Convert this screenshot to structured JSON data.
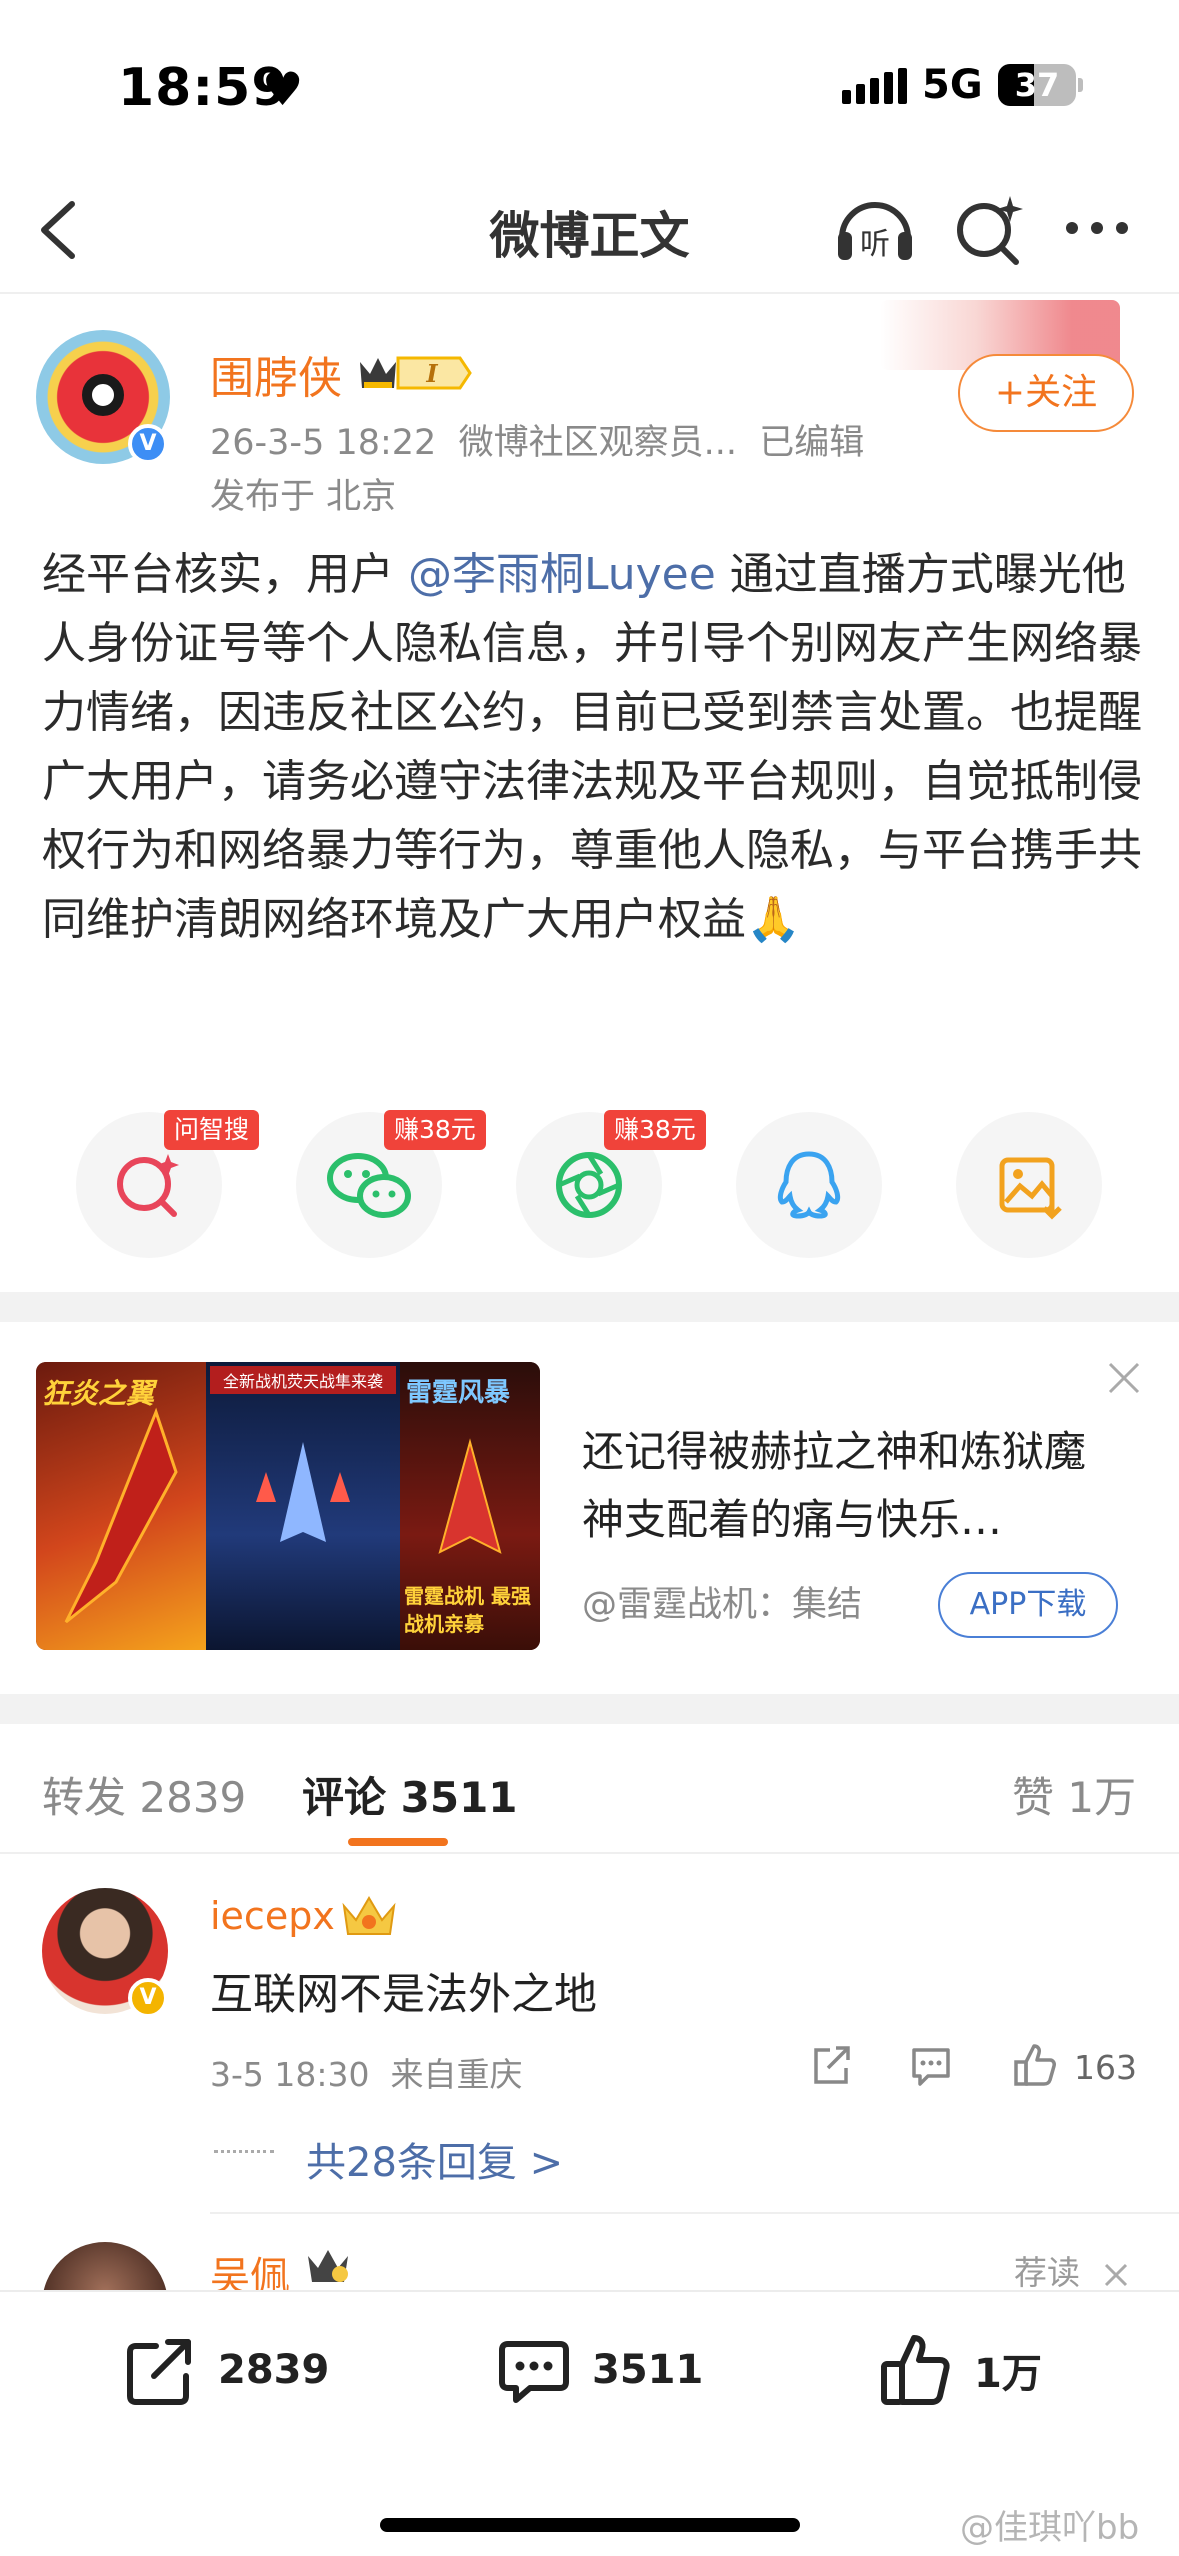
{
  "status_bar": {
    "time": "18:59",
    "network": "5G",
    "battery": "37"
  },
  "nav": {
    "title": "微博正文"
  },
  "post": {
    "username": "围脖侠",
    "badge_level": "I",
    "meta": "26-3-5 18:22  微博社区观察员...  已编辑",
    "location": "发布于 北京",
    "follow_label": "+关注",
    "text_before": "经平台核实，用户 ",
    "mention": "@李雨桐Luyee",
    "text_after": " 通过直播方式曝光他人身份证号等个人隐私信息，并引导个别网友产生网络暴力情绪，因违反社区公约，目前已受到禁言处置。也提醒广大用户，请务必遵守法律法规及平台规则，自觉抵制侵权行为和网络暴力等行为，尊重他人隐私，与平台携手共同维护清朗网络环境及广大用户权益🙏"
  },
  "share": {
    "items": [
      {
        "icon": "ai-search-icon",
        "tag": "问智搜"
      },
      {
        "icon": "wechat-icon",
        "tag": "赚38元"
      },
      {
        "icon": "moments-icon",
        "tag": "赚38元"
      },
      {
        "icon": "qq-icon",
        "tag": ""
      },
      {
        "icon": "save-image-icon",
        "tag": ""
      }
    ]
  },
  "ad": {
    "title": "还记得被赫拉之神和炼狱魔神支配着的痛与快乐…",
    "source": "@雷霆战机：集结",
    "button": "APP下载",
    "image_text_left": "狂炎之翼",
    "image_text_mid": "全新战机荧天战隼来袭",
    "image_text_right_top": "雷霆风暴",
    "image_text_right_bottom": "雷霆战机 最强战机亲募"
  },
  "tabs": {
    "repost_label": "转发",
    "repost_count": "2839",
    "comment_label": "评论",
    "comment_count": "3511",
    "like_label": "赞",
    "like_count": "1万"
  },
  "comments": [
    {
      "name": "iecepx",
      "text": "互联网不是法外之地",
      "meta": "3-5 18:30  来自重庆",
      "likes": "163",
      "replies": "共28条回复 >"
    },
    {
      "name": "吴佩",
      "recommend": "荐读"
    }
  ],
  "bottom": {
    "repost": "2839",
    "comment": "3511",
    "like": "1万"
  },
  "watermark": "@佳琪吖bb",
  "colors": {
    "accent": "#f2741e",
    "link": "#4d6ea8",
    "tag_red": "#f0433a"
  }
}
